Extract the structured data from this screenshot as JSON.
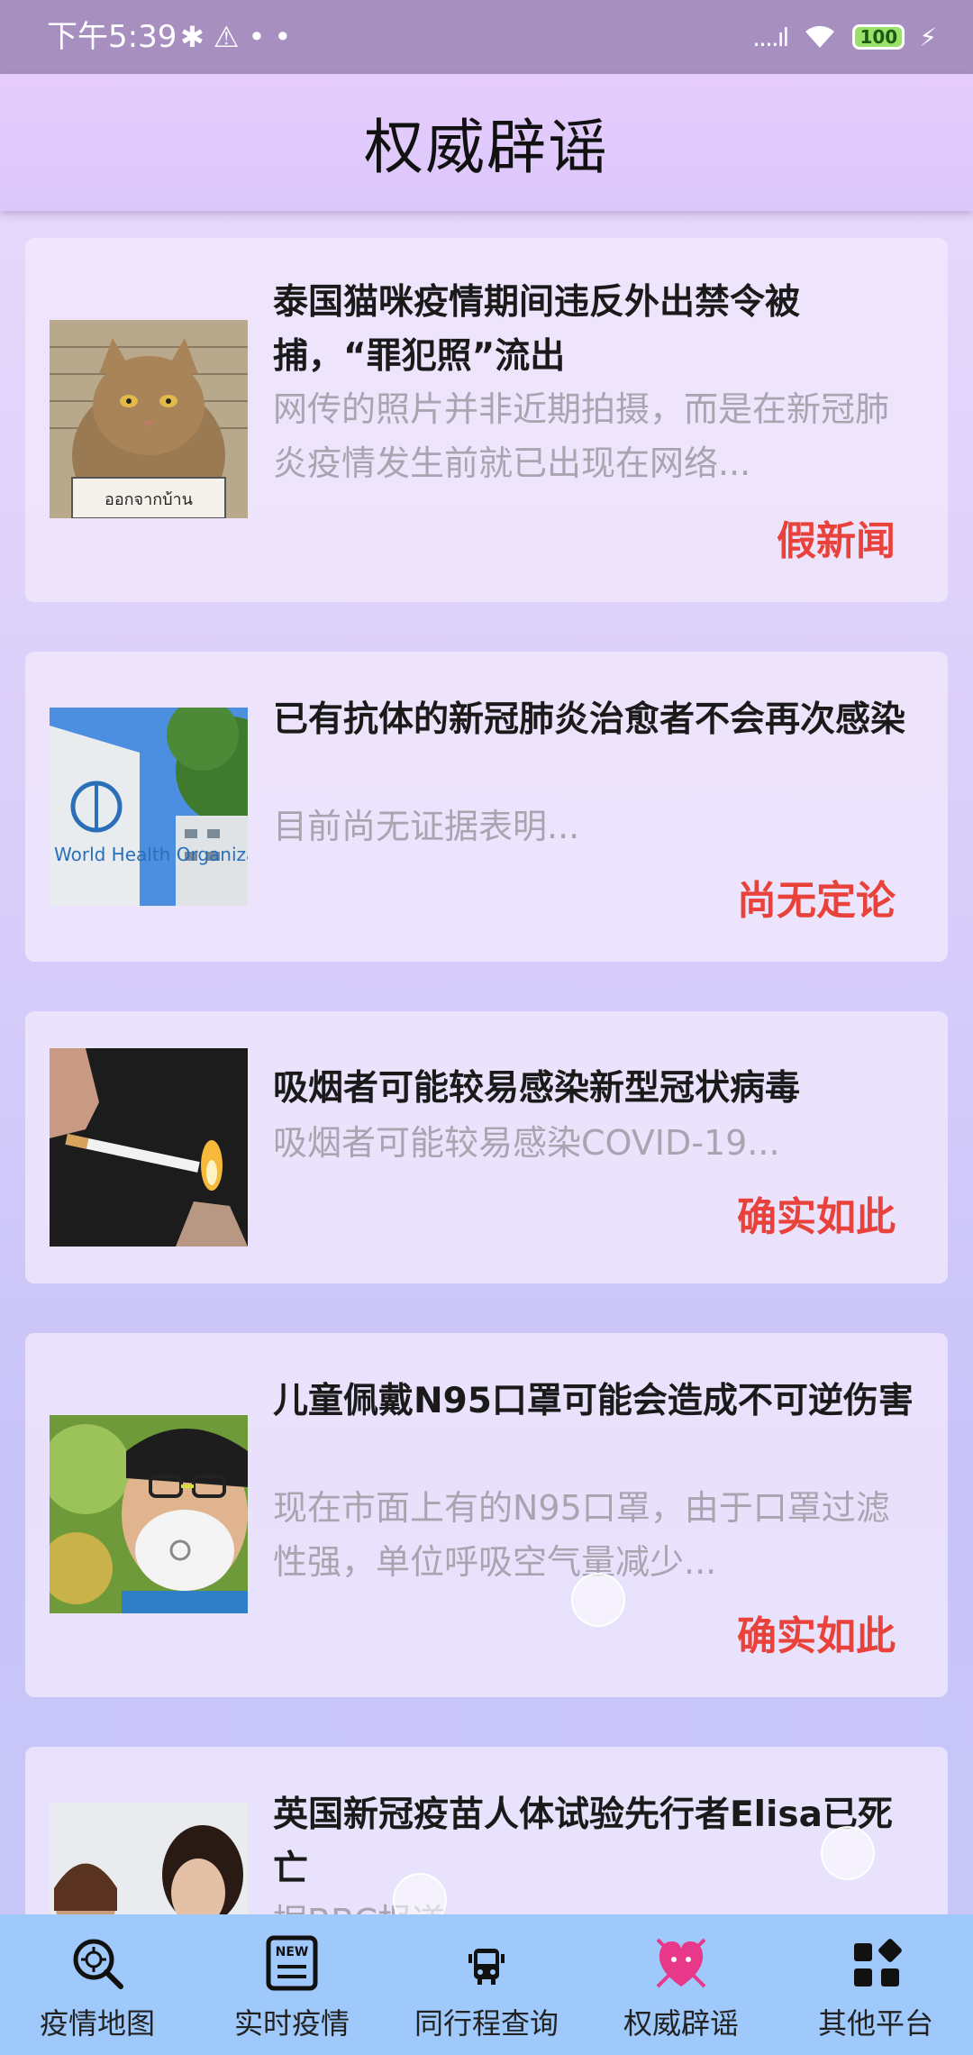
{
  "status_bar": {
    "time": "下午5:39",
    "left_icons": [
      "bluetooth-icon",
      "warning-icon",
      "more-dots-icon"
    ],
    "signal": "....ıl",
    "battery": "100"
  },
  "header": {
    "title": "权威辟谣"
  },
  "articles": [
    {
      "title": "泰国猫咪疫情期间违反外出禁令被捕，“罪犯照”流出",
      "desc": "网传的照片并非近期拍摄，而是在新冠肺炎疫情发生前就已出现在网络...",
      "verdict": "假新闻",
      "thumb": "cat-mugshot-image",
      "sign_text": "ออกจากบ้าน"
    },
    {
      "title": "已有抗体的新冠肺炎治愈者不会再次感染",
      "desc": "目前尚无证据表明...",
      "verdict": "尚无定论",
      "thumb": "who-sign-image",
      "sign_text": "World Health Organization"
    },
    {
      "title": "吸烟者可能较易感染新型冠状病毒",
      "desc": "吸烟者可能较易感染COVID-19...",
      "verdict": "确实如此",
      "thumb": "smoking-image"
    },
    {
      "title": "儿童佩戴N95口罩可能会造成不可逆伤害",
      "desc": "现在市面上有的N95口罩，由于口罩过滤性强，单位呼吸空气量减少...",
      "verdict": "确实如此",
      "thumb": "child-mask-image"
    },
    {
      "title": "英国新冠疫苗人体试验先行者Elisa已死亡",
      "desc": "据BBC报道...",
      "verdict": "",
      "thumb": "vaccine-trial-image"
    }
  ],
  "nav": [
    {
      "label": "疫情地图",
      "icon": "virus-search-icon"
    },
    {
      "label": "实时疫情",
      "icon": "news-icon"
    },
    {
      "label": "同行程查询",
      "icon": "bus-icon"
    },
    {
      "label": "权威辟谣",
      "icon": "rumor-buster-icon",
      "active": true
    },
    {
      "label": "其他平台",
      "icon": "apps-grid-icon"
    }
  ],
  "colors": {
    "verdict": "#e8423a",
    "status_bar": "#a78fc0",
    "bottom_nav": "#9fc8fb",
    "active_icon": "#e8388a"
  }
}
